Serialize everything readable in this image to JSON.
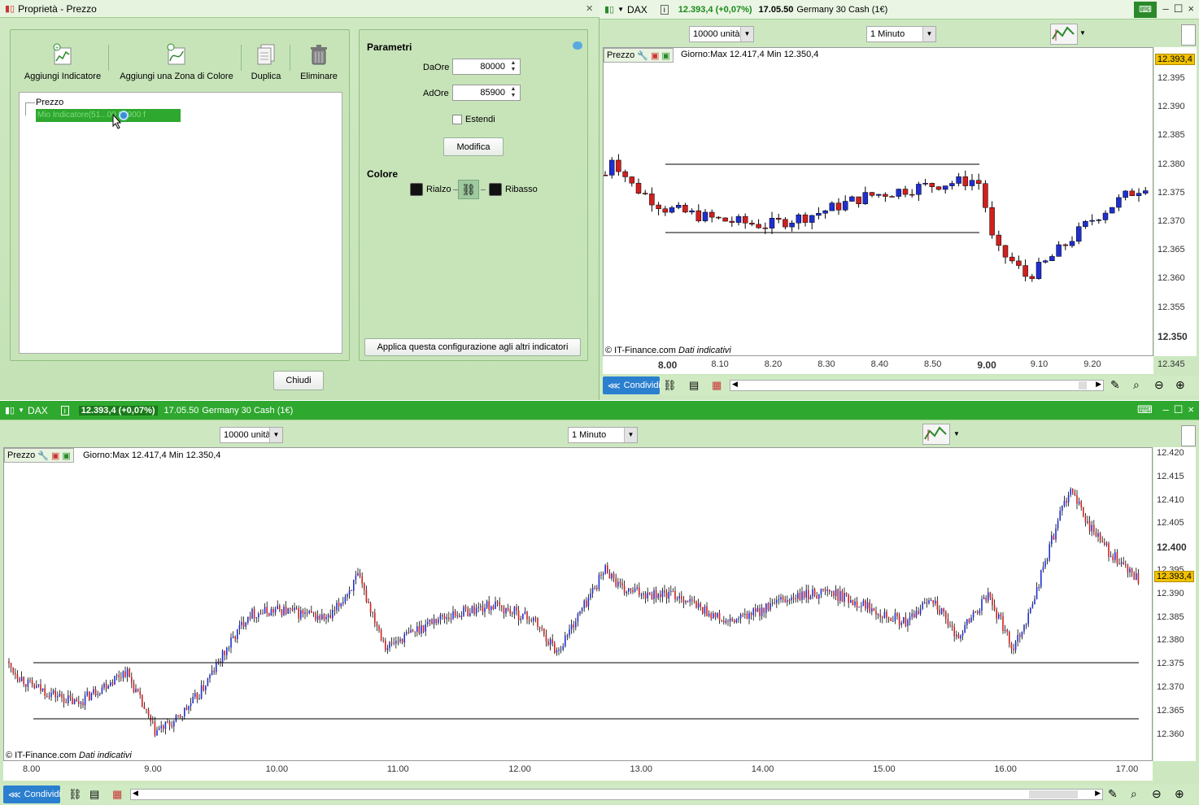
{
  "props_window": {
    "title": "Proprietà - Prezzo",
    "toolbar": {
      "add_indicator": "Aggiungi Indicatore",
      "add_zone": "Aggiungi una Zona di Colore",
      "duplicate": "Duplica",
      "delete": "Eliminare"
    },
    "tree": {
      "root": "Prezzo",
      "selected_item": "Mio Indicatore(51...00 85900 f"
    },
    "params": {
      "title": "Parametri",
      "from_label": "DaOre",
      "from_value": "80000",
      "to_label": "AdOre",
      "to_value": "85900",
      "extend_label": "Estendi",
      "modify_label": "Modifica",
      "color_title": "Colore",
      "rise_label": "Rialzo",
      "fall_label": "Ribasso",
      "apply_label": "Applica questa configurazione agli altri indicatori"
    },
    "close_label": "Chiudi"
  },
  "top_chart": {
    "symbol": "DAX",
    "quote": "12.393,4 (+0,07%)",
    "time": "17.05.50",
    "instrument": "Germany 30 Cash (1€)",
    "units": "10000 unità",
    "timeframe": "1 Minuto",
    "panel_label": "Prezzo",
    "day_info": "Giorno:Max 12.417,4 Min 12.350,4",
    "copyright": "© IT-Finance.com",
    "indicative": "Dati indicativi",
    "price_badge": "12.393,4",
    "share_label": "Condividi",
    "y_ticks": [
      "12.395",
      "12.390",
      "12.385",
      "12.380",
      "12.375",
      "12.370",
      "12.365",
      "12.360",
      "12.355",
      "12.350",
      "12.345"
    ],
    "x_ticks": [
      "8.00",
      "8.10",
      "8.20",
      "8.30",
      "8.40",
      "8.50",
      "9.00",
      "9.10",
      "9.20"
    ]
  },
  "bottom_chart": {
    "symbol": "DAX",
    "quote": "12.393,4 (+0,07%)",
    "time": "17.05.50",
    "instrument": "Germany 30 Cash (1€)",
    "units": "10000 unità",
    "timeframe": "1 Minuto",
    "panel_label": "Prezzo",
    "day_info": "Giorno:Max 12.417,4 Min 12.350,4",
    "copyright": "© IT-Finance.com",
    "indicative": "Dati indicativi",
    "price_badge": "12.393,4",
    "share_label": "Condividi",
    "y_ticks": [
      "12.420",
      "12.415",
      "12.410",
      "12.405",
      "12.400",
      "12.395",
      "12.390",
      "12.385",
      "12.380",
      "12.375",
      "12.370",
      "12.365",
      "12.360"
    ],
    "x_ticks": [
      "8.00",
      "9.00",
      "10.00",
      "11.00",
      "12.00",
      "13.00",
      "14.00",
      "15.00",
      "16.00",
      "17.00"
    ]
  },
  "colors": {
    "up": "#1f2fd0",
    "down": "#d01f1f",
    "accent_green": "#2ea82e",
    "price_badge": "#f2c200"
  }
}
